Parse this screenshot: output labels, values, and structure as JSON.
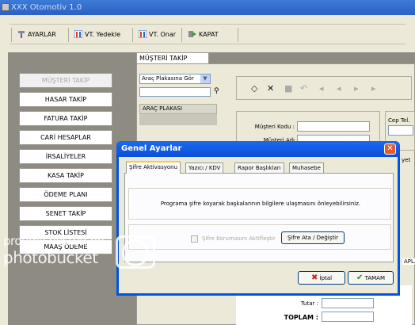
{
  "app": {
    "title": "XXX Otomotiv 1.0"
  },
  "toolbar": {
    "settings_label": "AYARLAR",
    "db_backup_label": "VT. Yedekle",
    "db_repair_label": "VT. Onar",
    "close_label": "KAPAT"
  },
  "menu": {
    "items": [
      "MÜŞTERİ TAKİP",
      "HASAR TAKİP",
      "FATURA TAKİP",
      "CARİ HESAPLAR",
      "İRSALİYELER",
      "KASA TAKİP",
      "ÖDEME PLANI",
      "SENET TAKİP",
      "STOK LİSTESİ",
      "MAAŞ ÖDEME"
    ]
  },
  "customer": {
    "tab_label": "MÜŞTERİ TAKİP",
    "search_combo": "Araç Plakasına Gör",
    "list_header": "ARAÇ PLAKASI",
    "customer_code_label": "Müşteri Kodu :",
    "customer_name_label": "Müşteri Adı",
    "phone_label": "Cep Tel.",
    "total_label": "Tutar :",
    "grand_total_label": "TOPLAM :",
    "partial_right_1": "yet",
    "partial_right_2": "APLA"
  },
  "dialog": {
    "title": "Genel Ayarlar",
    "tabs": [
      "Şifre Aktivasyonu",
      "Yazıcı / KDV",
      "Rapor Başlıkları",
      "Muhasebe"
    ],
    "message": "Programa şifre koyarak başkalarının bilgilere ulaşmasını önleyebilirsiniz.",
    "checkbox_label": "Şifre Korumasını Aktifleştir",
    "set_password_label": "Şifre Ata / Değiştir",
    "cancel_label": "İptal",
    "ok_label": "TAMAM"
  },
  "watermark": {
    "line1": "proudly hosted on",
    "line2": "photobucket"
  }
}
